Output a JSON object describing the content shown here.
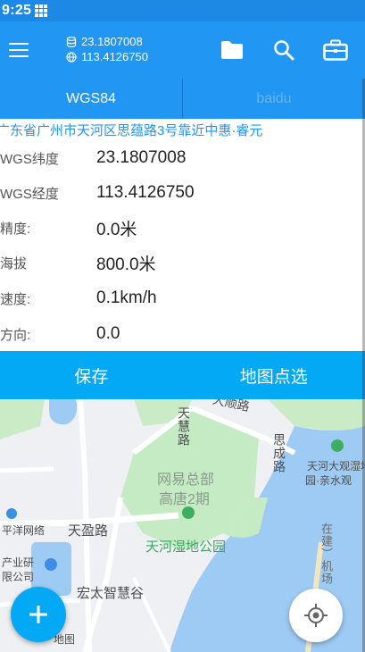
{
  "status_bar": {
    "time": "9:25"
  },
  "app_bar": {
    "latitude": "23.1807008",
    "longitude": "113.4126750",
    "icons": [
      "menu-icon",
      "folder-icon",
      "search-icon",
      "briefcase-icon"
    ]
  },
  "tabs": [
    {
      "label": "WGS84",
      "active": true
    },
    {
      "label": "baidu",
      "active": false
    }
  ],
  "address": "广东省广州市天河区思蕴路3号靠近中惠·睿元",
  "info": [
    {
      "label": "WGS纬度",
      "value": "23.1807008"
    },
    {
      "label": "WGS经度",
      "value": "113.4126750"
    },
    {
      "label": "精度:",
      "value": "0.0米"
    },
    {
      "label": "海拔",
      "value": "800.0米"
    },
    {
      "label": "速度:",
      "value": "0.1km/h"
    },
    {
      "label": "方向:",
      "value": "0.0"
    }
  ],
  "actions": {
    "save": "保存",
    "map_pick": "地图点选"
  },
  "map": {
    "labels": {
      "tianhui_road": "天慧路",
      "dadun_road": "大顺路",
      "siyun_road": "思成路",
      "netease": "网易总部",
      "gaotang": "高唐2期",
      "tianying_road": "天盈路",
      "wetland_park": "天河湿地公园",
      "wetland_scenic": "天河大观湿地",
      "water_view": "园·亲水观",
      "pingyang": "平洋网络",
      "industry": "产业研",
      "company": "限公司",
      "hongtai": "宏太智慧谷",
      "xianjian": "在建）机场",
      "map_small": "地图"
    }
  },
  "colors": {
    "primary": "#2196f3",
    "status_bar": "#1e88e5",
    "accent": "#03a9f4",
    "address": "#2196f3",
    "water": "#9ecbf4",
    "park": "#c5ebc4"
  }
}
